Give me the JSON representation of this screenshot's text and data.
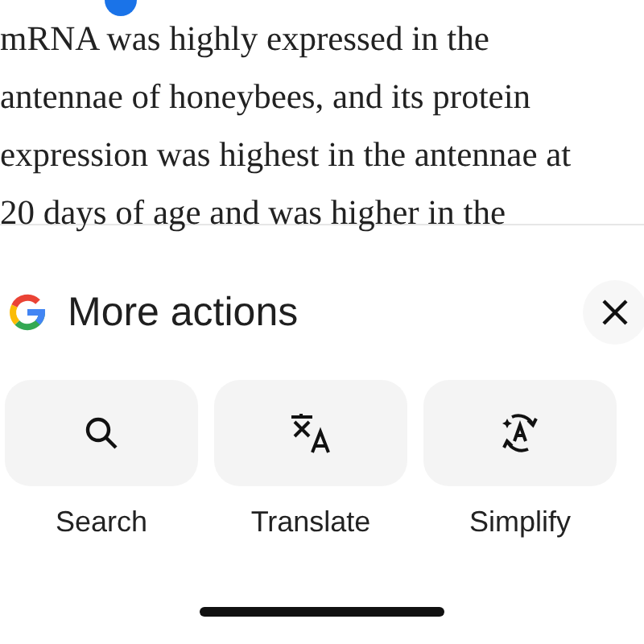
{
  "article": {
    "lines": [
      "mRNA was highly expressed in the",
      "antennae of honeybees, and its protein",
      "expression was highest in the antennae at",
      "20 days of age and was higher in the"
    ]
  },
  "sheet": {
    "title": "More actions",
    "actions": [
      {
        "kind": "search",
        "label": "Search"
      },
      {
        "kind": "translate",
        "label": "Translate"
      },
      {
        "kind": "simplify",
        "label": "Simplify"
      }
    ]
  }
}
